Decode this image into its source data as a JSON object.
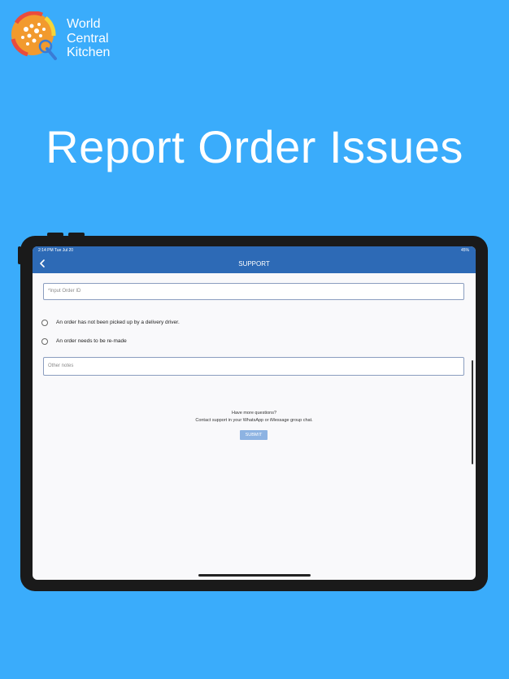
{
  "brand": {
    "line1": "World",
    "line2": "Central",
    "line3": "Kitchen"
  },
  "headline": "Report Order Issues",
  "device": {
    "status_time": "2:14 PM   Tue Jul 20",
    "status_right": "45%"
  },
  "nav": {
    "title": "SUPPORT"
  },
  "form": {
    "order_id_placeholder": "*Input Order ID",
    "options": [
      {
        "label": "An order has not been picked up by a delivery driver."
      },
      {
        "label": "An order needs to be re-made"
      }
    ],
    "notes_placeholder": "Other notes",
    "help_line1": "Have more questions?",
    "help_line2": "Contact support in your WhatsApp or iMessage group chat.",
    "submit_label": "SUBMIT"
  },
  "colors": {
    "background": "#3aacfb",
    "nav_bar": "#2d6ab6",
    "submit": "#8db3e2"
  }
}
